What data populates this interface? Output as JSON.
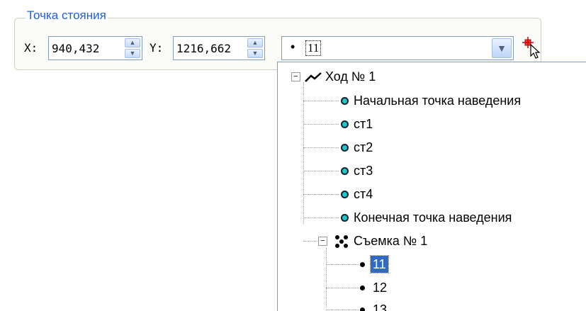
{
  "group": {
    "title": "Точка стояния"
  },
  "fields": {
    "x_label": "X:",
    "x_value": "940,432",
    "y_label": "Y:",
    "y_value": "1216,662"
  },
  "combo": {
    "selected": "11"
  },
  "tree": {
    "root": "Ход № 1",
    "children": [
      "Начальная точка наведения",
      "ст1",
      "ст2",
      "ст3",
      "ст4",
      "Конечная точка наведения"
    ],
    "survey": "Съемка № 1",
    "points": [
      "11",
      "12",
      "13"
    ],
    "selected": "11"
  },
  "colors": {
    "group_title": "#1f5fd6",
    "selection": "#316ac5",
    "station_dot": "#1ec8c8"
  }
}
